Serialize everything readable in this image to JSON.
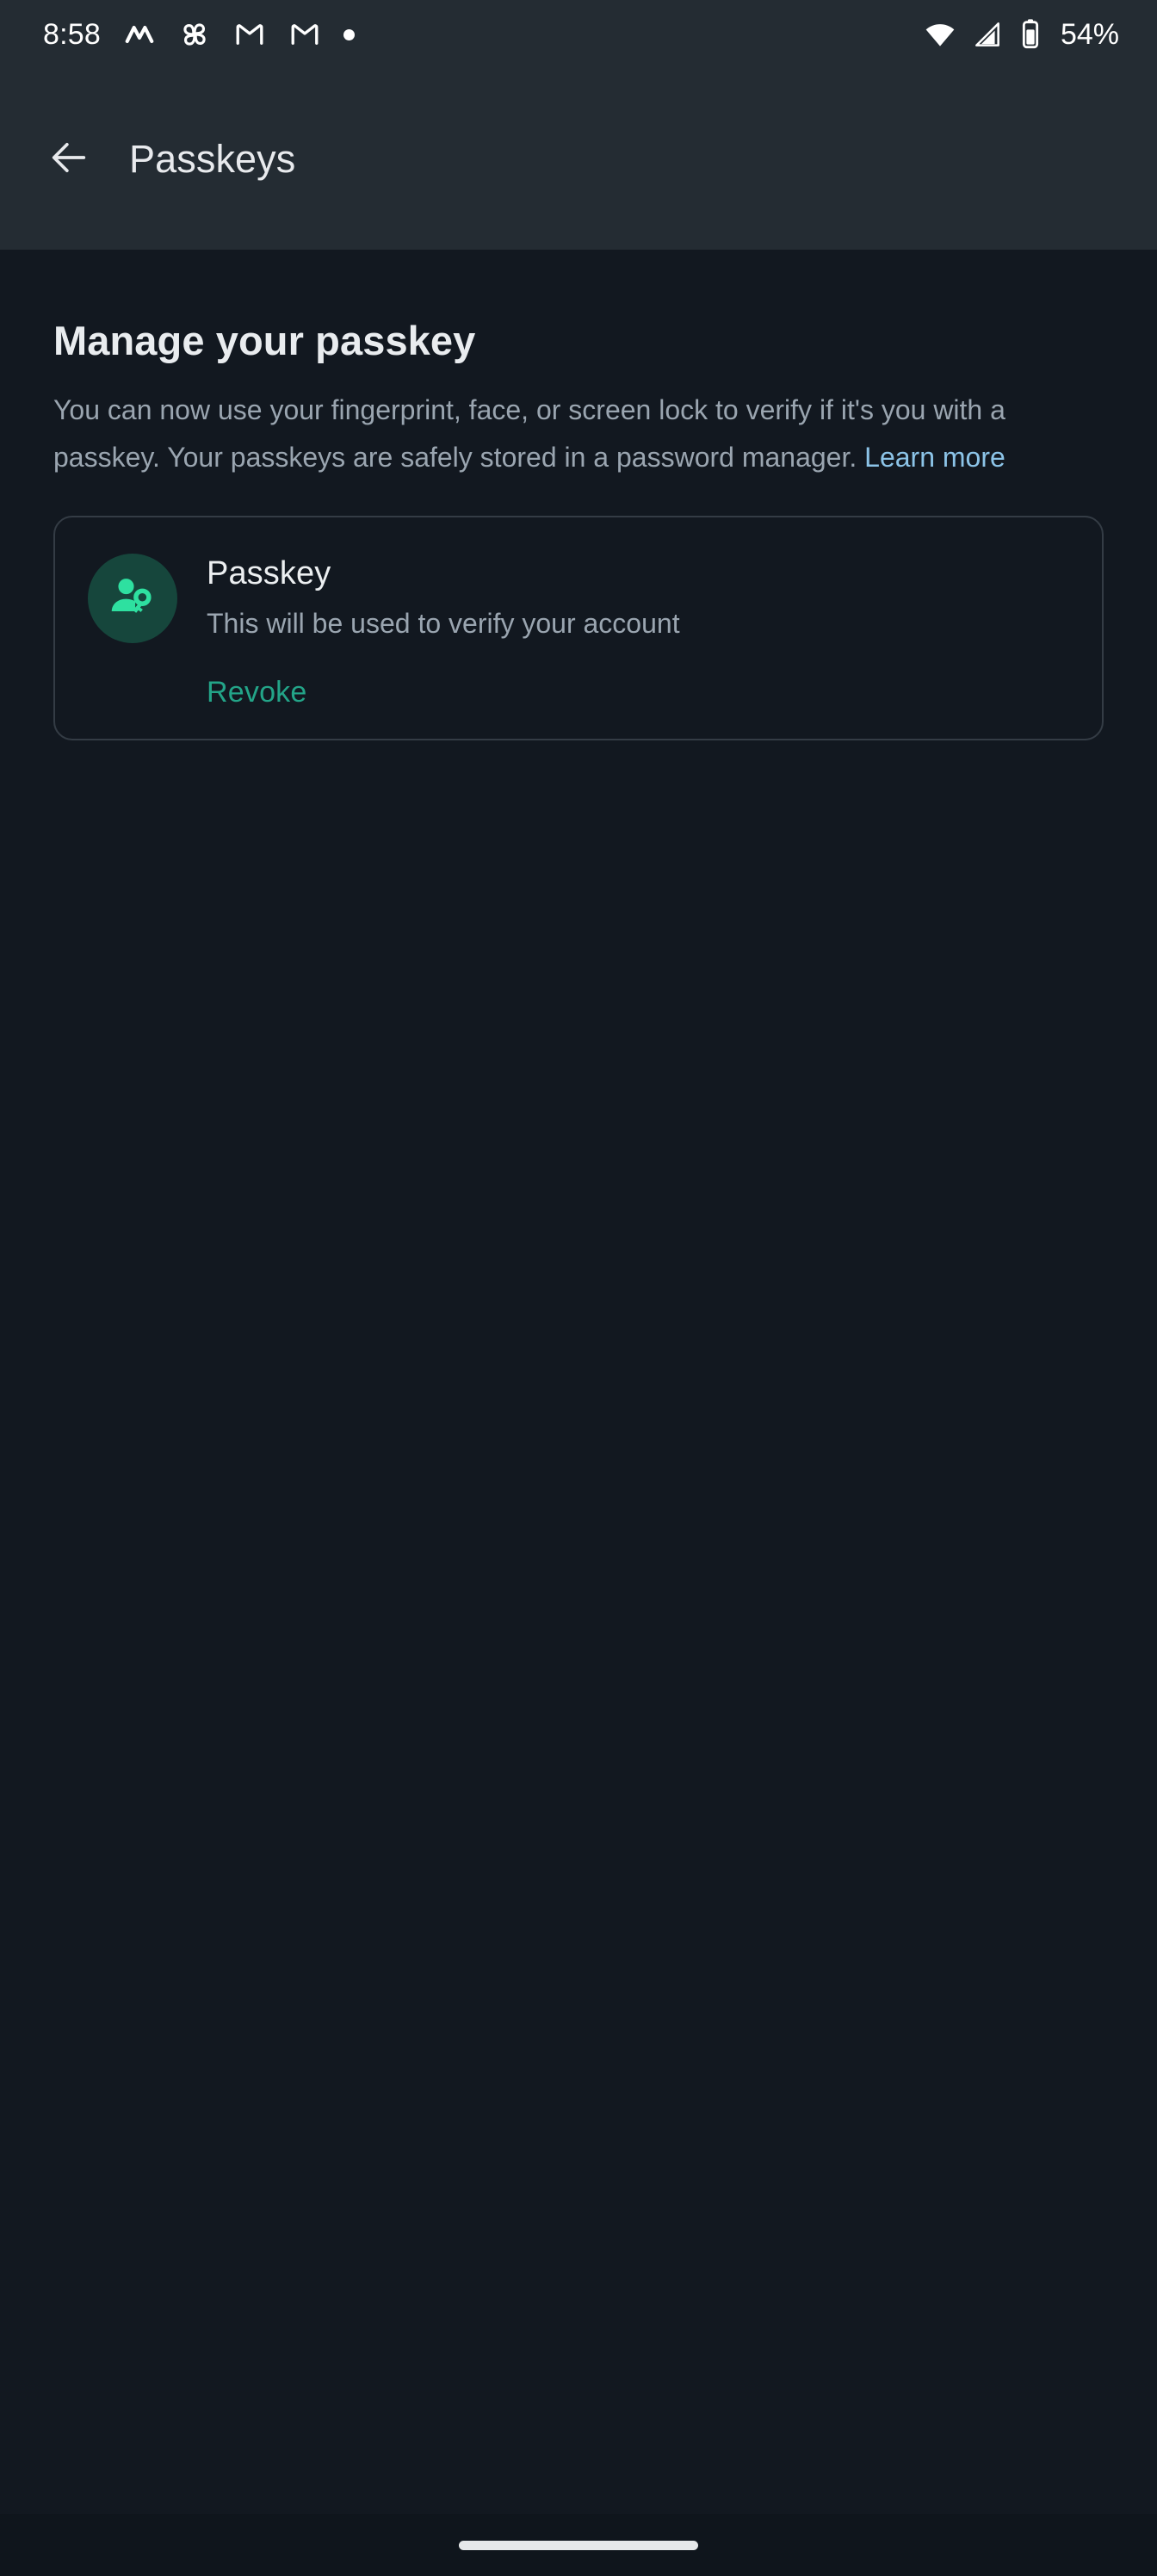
{
  "status_bar": {
    "time": "8:58",
    "battery_percent": "54%",
    "left_icons": [
      "monument-valley-app-icon",
      "pinwheel-app-icon",
      "gmail-icon",
      "gmail-icon",
      "notification-dot-icon"
    ],
    "right_icons": [
      "wifi-icon",
      "cellular-signal-icon",
      "battery-icon"
    ]
  },
  "app_bar": {
    "back_icon": "back-arrow-icon",
    "title": "Passkeys"
  },
  "main": {
    "heading": "Manage your passkey",
    "body": "You can now use your fingerprint, face, or screen lock to verify if it's you with a passkey. Your passkeys are safely stored in a password manager.",
    "learn_more_label": "Learn more",
    "card": {
      "icon": "person-key-icon",
      "title": "Passkey",
      "subtitle": "This will be used to verify your account",
      "action_label": "Revoke"
    }
  },
  "nav_bar": {
    "gesture_pill": "home-gesture-pill"
  },
  "colors": {
    "status_bar_bg": "#242c33",
    "page_bg": "#121820",
    "accent_green": "#23a488",
    "icon_green": "#2ee0a0",
    "avatar_bg": "#16463c",
    "link_blue": "#8cc4e8",
    "primary_text": "#e9ecef",
    "secondary_text": "#9aa5b0",
    "card_border": "#343c45"
  }
}
